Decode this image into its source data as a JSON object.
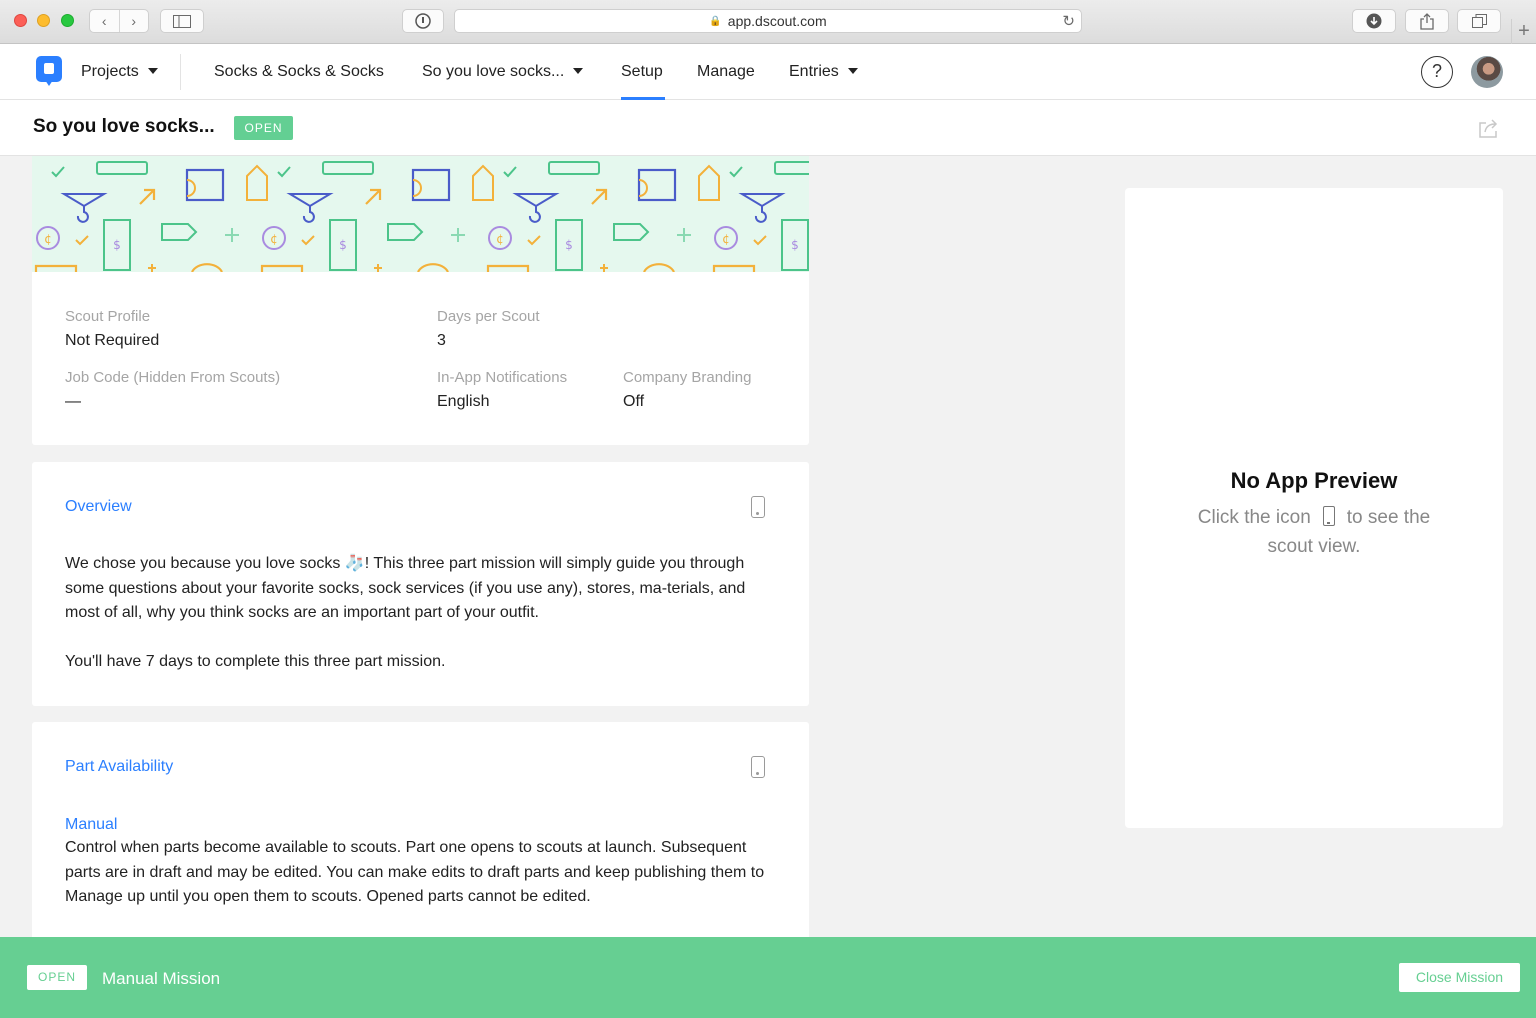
{
  "browser": {
    "url": "app.dscout.com",
    "icons": [
      "back-icon",
      "forward-icon",
      "sidebar-icon",
      "password-icon",
      "lock-icon",
      "reload-icon",
      "download-icon",
      "share-icon",
      "tabs-icon",
      "new-tab-icon"
    ]
  },
  "nav": {
    "projects_label": "Projects",
    "project_name": "Socks & Socks & Socks",
    "mission_name": "So you love socks...",
    "tabs": [
      {
        "label": "Setup",
        "active": true
      },
      {
        "label": "Manage",
        "active": false
      },
      {
        "label": "Entries",
        "active": false
      }
    ],
    "help_symbol": "?",
    "accent_color": "#2b7fff"
  },
  "header": {
    "title": "So you love socks...",
    "status": "OPEN"
  },
  "settings": {
    "scout_profile_label": "Scout Profile",
    "scout_profile_value": "Not Required",
    "days_label": "Days per Scout",
    "days_value": "3",
    "job_code_label": "Job Code (Hidden From Scouts)",
    "job_code_value": "—",
    "notifications_label": "In-App Notifications",
    "notifications_value": "English",
    "branding_label": "Company Branding",
    "branding_value": "Off"
  },
  "overview": {
    "title": "Overview",
    "p1_before": "We chose you because you love socks ",
    "p1_emoji": "🧦",
    "p1_after": "! This three part mission will simply guide you through some questions about your favorite socks, sock services (if you use any), stores, ma-terials, and most of all, why you think socks are an important part of your outfit.",
    "p2": "You'll have 7 days to complete this three part mission."
  },
  "parts": {
    "title": "Part Availability",
    "subtitle": "Manual",
    "description": "Control when parts become available to scouts. Part one opens to scouts at launch. Subsequent parts are in draft and may be edited. You can make edits to draft parts and keep publishing them to Manage up until you open them to scouts. Opened parts cannot be edited."
  },
  "preview": {
    "title": "No App Preview",
    "line1_before": "Click the icon",
    "line1_after": "to see the",
    "line2": "scout view."
  },
  "footer": {
    "status": "OPEN",
    "mission_type": "Manual Mission",
    "close_label": "Close Mission",
    "bg_color": "#66cf92"
  }
}
